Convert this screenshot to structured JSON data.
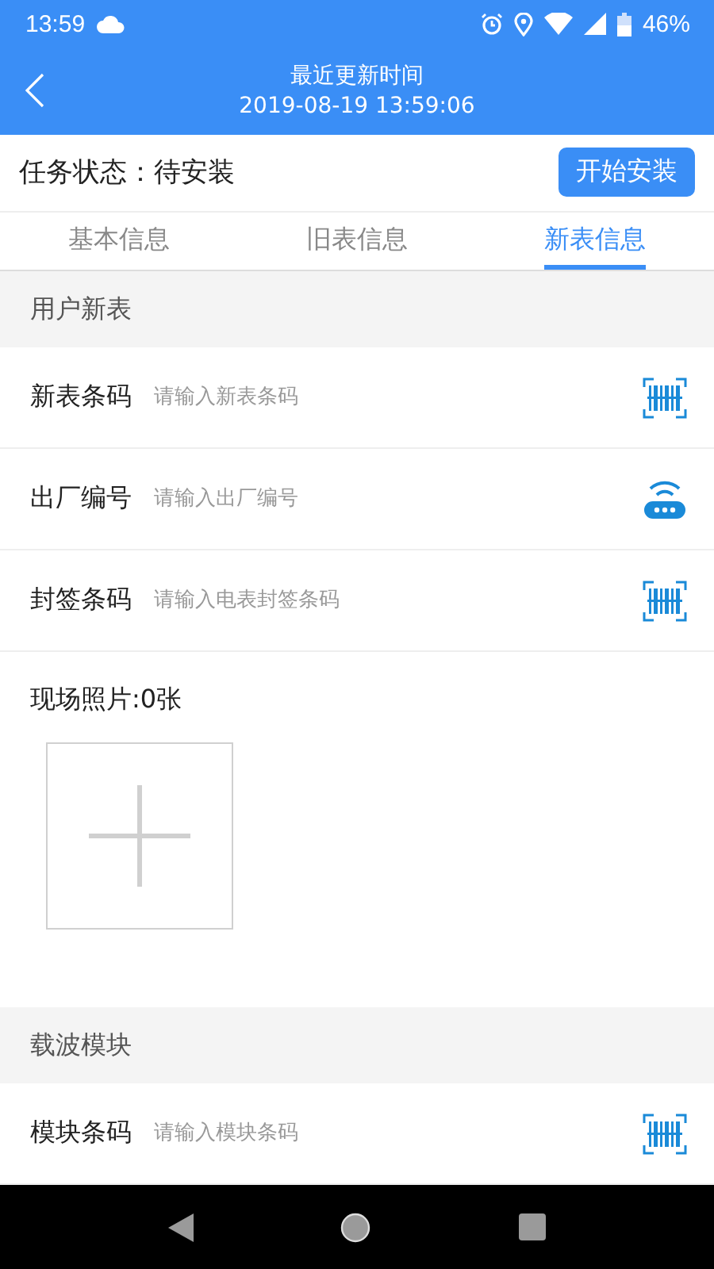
{
  "status_bar": {
    "time": "13:59",
    "battery": "46%"
  },
  "header": {
    "title": "最近更新时间",
    "subtitle": "2019-08-19 13:59:06"
  },
  "task": {
    "status": "任务状态：待安装",
    "button": "开始安装"
  },
  "tabs": [
    {
      "label": "基本信息",
      "selected": false
    },
    {
      "label": "旧表信息",
      "selected": false
    },
    {
      "label": "新表信息",
      "selected": true
    }
  ],
  "sections": [
    {
      "title": "用户新表",
      "fields": [
        {
          "label": "新表条码",
          "placeholder": "请输入新表条码",
          "kind": "barcode"
        },
        {
          "label": "出厂编号",
          "placeholder": "请输入出厂编号",
          "kind": "wireless"
        },
        {
          "label": "封签条码",
          "placeholder": "请输入电表封签条码",
          "kind": "barcode"
        }
      ],
      "photos": {
        "label": "现场照片:0张"
      }
    },
    {
      "title": "载波模块",
      "fields": [
        {
          "label": "模块条码",
          "placeholder": "请输入模块条码",
          "kind": "barcode"
        }
      ]
    }
  ]
}
